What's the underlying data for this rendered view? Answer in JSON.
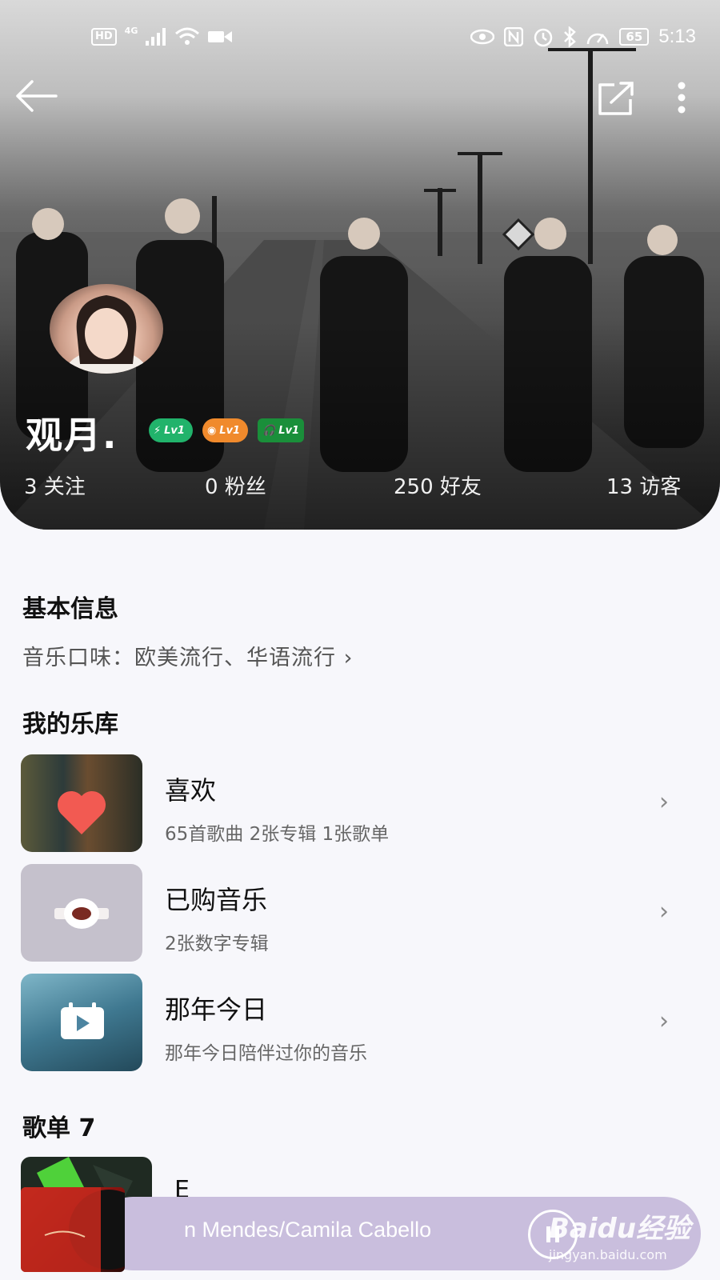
{
  "status_bar": {
    "hd": "HD",
    "network": "4G",
    "battery": "65",
    "time": "5:13"
  },
  "profile": {
    "username": "观月.",
    "badges": [
      "Lv1",
      "Lv1",
      "Lv1"
    ],
    "stats": {
      "following": "3 关注",
      "fans": "0 粉丝",
      "friends": "250 好友",
      "visitors": "13 访客"
    }
  },
  "basic_info": {
    "title": "基本信息",
    "taste": "音乐口味：欧美流行、华语流行 ›"
  },
  "library": {
    "title": "我的乐库",
    "items": [
      {
        "title": "喜欢",
        "subtitle": "65首歌曲 2张专辑 1张歌单",
        "icon": "heart-icon"
      },
      {
        "title": "已购音乐",
        "subtitle": "2张数字专辑",
        "icon": "vinyl-icon"
      },
      {
        "title": "那年今日",
        "subtitle": "那年今日陪伴过你的音乐",
        "icon": "calendar-play-icon"
      }
    ]
  },
  "playlists": {
    "title": "歌单 7",
    "first_name": "E"
  },
  "player": {
    "song": "n Mendes/Camila Cabello"
  },
  "watermark": {
    "main": "Baidu经验",
    "sub": "jingyan.baidu.com"
  },
  "colors": {
    "vip_badge": "#21b36b",
    "music_badge": "#f08a2c",
    "listen_badge": "#1a8f3a",
    "player_bg": "#c9bedd",
    "page_bg": "#f7f7fb"
  }
}
